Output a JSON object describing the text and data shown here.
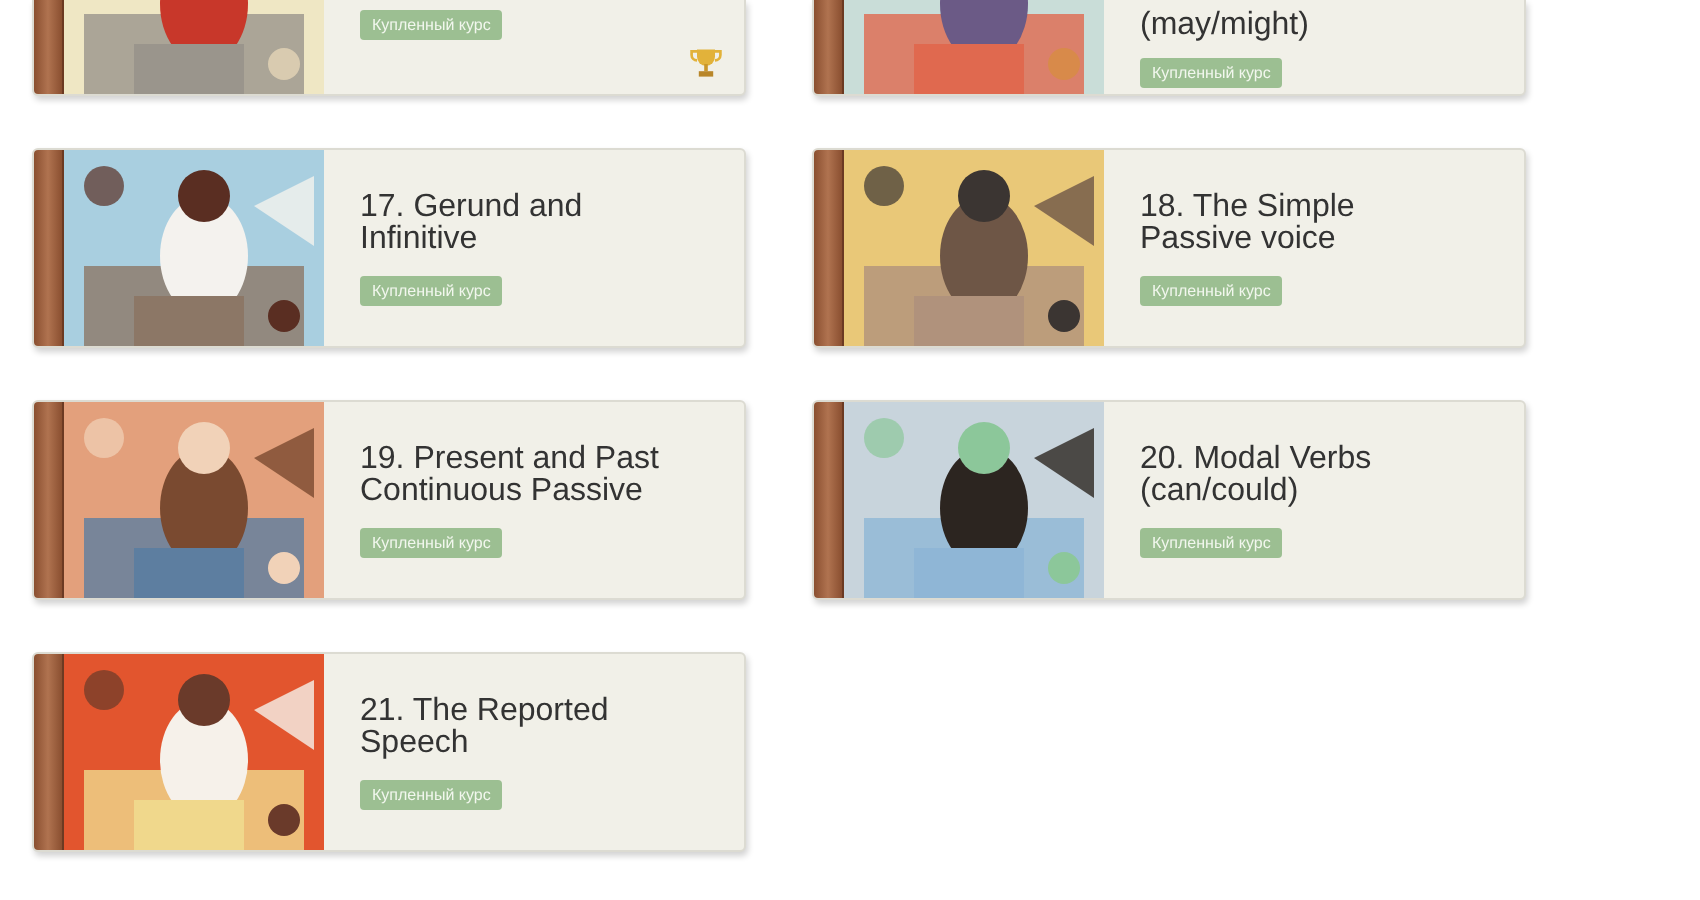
{
  "courses": [
    {
      "badge": "Купленный курс",
      "trophy": true
    },
    {
      "title": "(may/might)",
      "badge": "Купленный курс"
    },
    {
      "title": "17. Gerund and Infinitive",
      "badge": "Купленный курс"
    },
    {
      "title": "18. The Simple Passive voice",
      "badge": "Купленный курс"
    },
    {
      "title": "19. Present and Past Continuous Passive",
      "badge": "Купленный курс"
    },
    {
      "title": "20. Modal Verbs (can/could)",
      "badge": "Купленный курс"
    },
    {
      "title": "21. The Reported Speech",
      "badge": "Купленный курс"
    }
  ]
}
